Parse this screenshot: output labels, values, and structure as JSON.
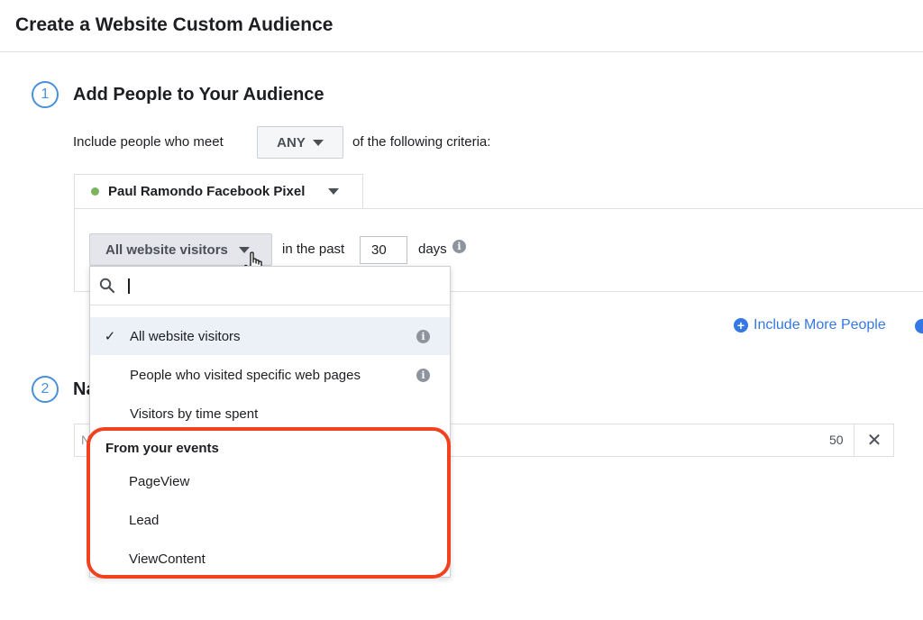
{
  "header": {
    "title": "Create a Website Custom Audience"
  },
  "step1": {
    "number": "1",
    "title": "Add People to Your Audience",
    "include_prefix": "Include people who meet",
    "match_select": "ANY",
    "include_suffix": "of the following criteria:",
    "pixel_name": "Paul Ramondo Facebook Pixel",
    "visitor_select": "All website visitors",
    "in_the_past_label": "in the past",
    "days_value": "30",
    "days_label": "days",
    "include_more_label": "Include More People"
  },
  "step2": {
    "number": "2",
    "title_fragment": "Na",
    "name_placeholder": "N",
    "char_count": "50",
    "clear_glyph": "✕"
  },
  "dropdown": {
    "search_value": "",
    "items": [
      {
        "label": "All website visitors",
        "selected": true,
        "has_info": true
      },
      {
        "label": "People who visited specific web pages",
        "selected": false,
        "has_info": true
      },
      {
        "label": "Visitors by time spent",
        "selected": false,
        "has_info": false
      }
    ],
    "events_group_label": "From your events",
    "events": [
      "PageView",
      "Lead",
      "ViewContent"
    ]
  },
  "colors": {
    "accent_blue": "#3578e5",
    "step_circle": "#4a90d9",
    "highlight": "#f2411f",
    "pixel_status": "#7ab55c"
  }
}
